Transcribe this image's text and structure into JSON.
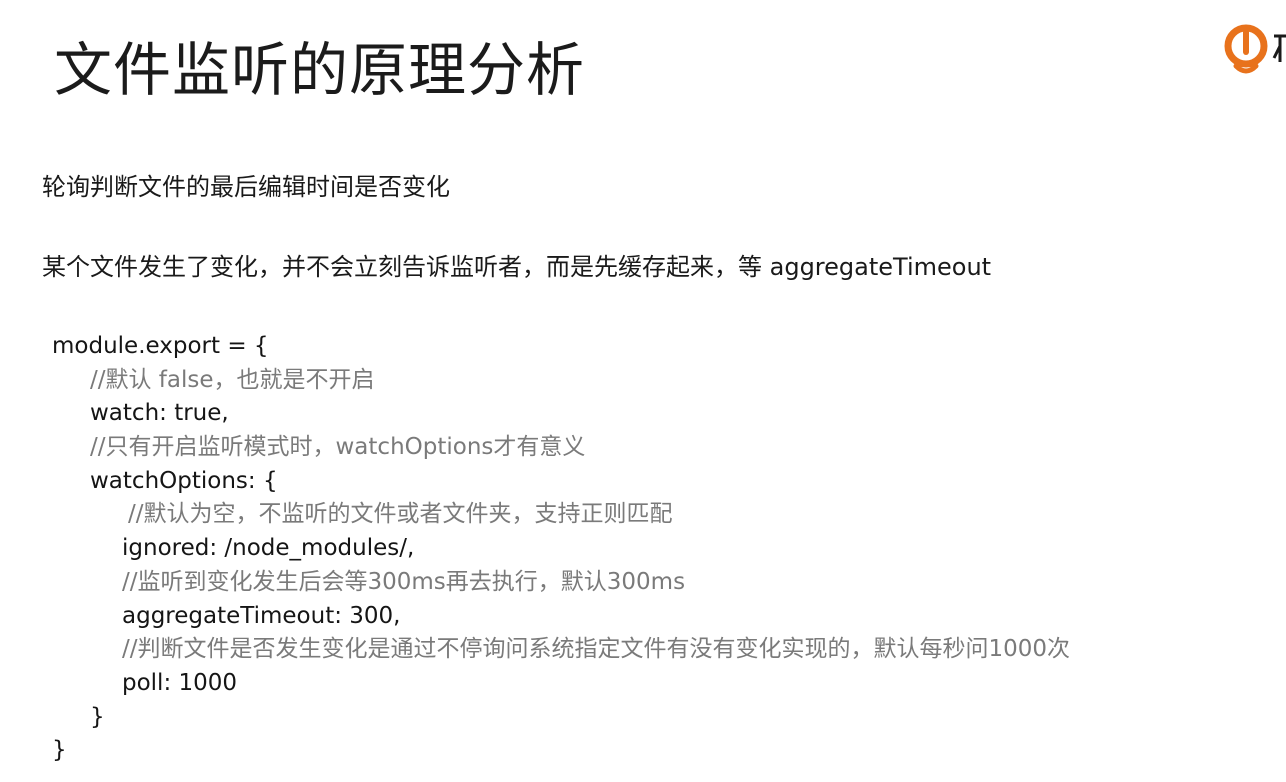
{
  "slide": {
    "title": "文件监听的原理分析"
  },
  "logo": {
    "icon": "brand-logo-icon",
    "color": "#E8721C"
  },
  "text": {
    "line1": "轮询判断文件的最后编辑时间是否变化",
    "line2": "某个文件发生了变化，并不会立刻告诉监听者，而是先缓存起来，等 aggregateTimeout"
  },
  "code": {
    "lines": [
      {
        "text": "module.export = {",
        "kind": "code"
      },
      {
        "text": "//默认 false，也就是不开启",
        "kind": "comment"
      },
      {
        "text": "watch: true,",
        "kind": "code"
      },
      {
        "text": "//只有开启监听模式时，watchOptions才有意义",
        "kind": "comment"
      },
      {
        "text": "watchOptions: {",
        "kind": "code"
      },
      {
        "text": "//默认为空，不监听的文件或者文件夹，支持正则匹配",
        "kind": "comment"
      },
      {
        "text": "ignored: /node_modules/,",
        "kind": "code"
      },
      {
        "text": "//监听到变化发生后会等300ms再去执行，默认300ms",
        "kind": "comment"
      },
      {
        "text": "aggregateTimeout: 300,",
        "kind": "code"
      },
      {
        "text": "//判断文件是否发生变化是通过不停询问系统指定文件有没有变化实现的，默认每秒问1000次",
        "kind": "comment"
      },
      {
        "text": "poll: 1000",
        "kind": "code"
      },
      {
        "text": "}",
        "kind": "code"
      },
      {
        "text": "}",
        "kind": "code"
      }
    ]
  },
  "colors": {
    "text": "#1a1a1a",
    "comment": "#7a7a7a",
    "background": "#ffffff"
  }
}
